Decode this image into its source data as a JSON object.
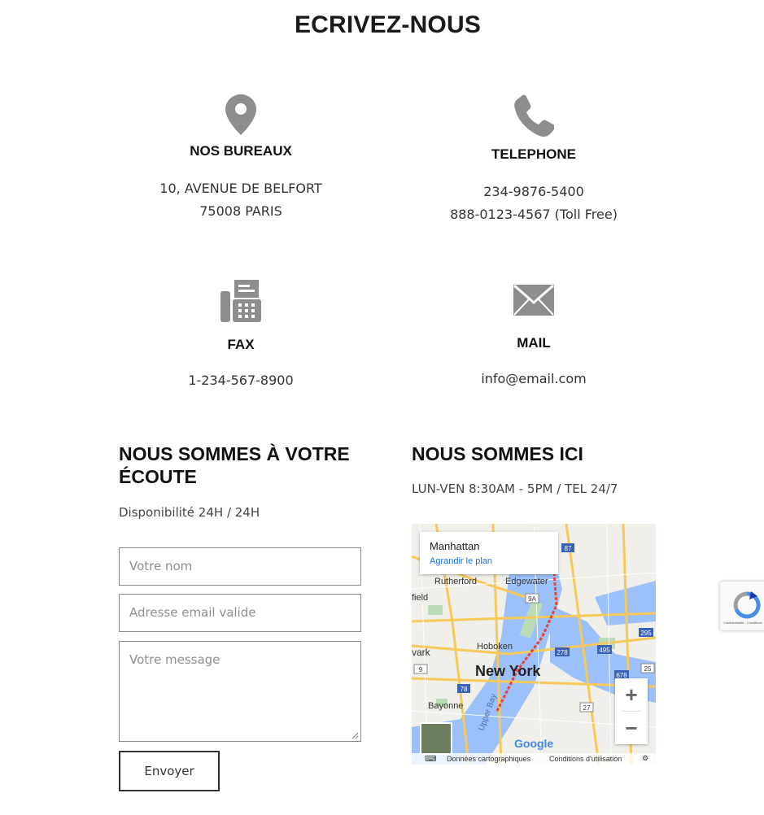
{
  "page_title": "ECRIVEZ-NOUS",
  "cards": {
    "offices": {
      "icon": "map-pin-icon",
      "title": "NOS BUREAUX",
      "line1": "10, AVENUE DE BELFORT",
      "line2": "75008 PARIS"
    },
    "phone": {
      "icon": "phone-icon",
      "title": "TELEPHONE",
      "line1": "234-9876-5400",
      "line2": "888-0123-4567 (Toll Free)"
    },
    "fax": {
      "icon": "fax-icon",
      "title": "FAX",
      "line1": "1-234-567-8900"
    },
    "mail": {
      "icon": "envelope-icon",
      "title": "MAIL",
      "line1": "info@email.com"
    }
  },
  "contact_form": {
    "title_line1": "NOUS SOMMES À VOTRE",
    "title_line2": "ÉCOUTE",
    "subtitle": "Disponibilité 24H / 24H",
    "name_placeholder": "Votre nom",
    "email_placeholder": "Adresse email valide",
    "message_placeholder": "Votre message",
    "submit_label": "Envoyer"
  },
  "location": {
    "title": "NOUS SOMMES ICI",
    "hours": "LUN-VEN 8:30AM - 5PM / TEL  24/7"
  },
  "map": {
    "place_name": "Manhattan",
    "enlarge_link": "Agrandir le plan",
    "city_label": "New York",
    "labels": [
      "Rutherford",
      "Edgewater",
      "Hoboken",
      "Bayonne",
      "Upper Bay",
      "vark",
      "field"
    ],
    "highway_shields": [
      "87",
      "9A",
      "278",
      "495",
      "295",
      "678",
      "78",
      "9",
      "27",
      "25"
    ],
    "zoom_in": "+",
    "zoom_out": "−",
    "logo": "Google",
    "footer_data": "Données cartographiques",
    "footer_terms": "Conditions d'utilisation",
    "colors": {
      "water": "#9cc0f9",
      "land": "#f0efe9",
      "road": "#f7c85a",
      "park": "#b9dbb5",
      "route": "#e94335"
    }
  },
  "recaptcha": {
    "icon": "recaptcha-icon",
    "text": "Confidentialité - Conditions"
  }
}
